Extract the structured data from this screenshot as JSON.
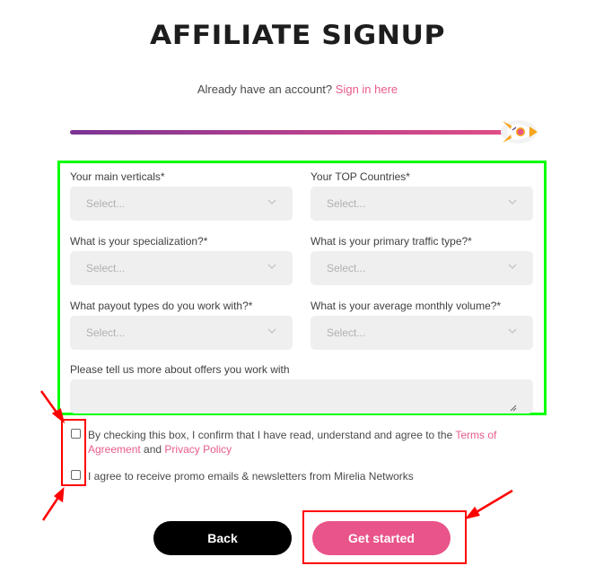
{
  "header": {
    "title": "AFFILIATE SIGNUP",
    "signin_prompt": "Already have an account?",
    "signin_link": "Sign in here"
  },
  "progress": {
    "value_percent": 100,
    "icon": "rocket-icon"
  },
  "form": {
    "fields": [
      {
        "label": "Your main verticals*",
        "placeholder": "Select..."
      },
      {
        "label": "Your TOP Countries*",
        "placeholder": "Select..."
      },
      {
        "label": "What is your specialization?*",
        "placeholder": "Select..."
      },
      {
        "label": "What is your primary traffic type?*",
        "placeholder": "Select..."
      },
      {
        "label": "What payout types do you work with?*",
        "placeholder": "Select..."
      },
      {
        "label": "What is your average monthly volume?*",
        "placeholder": "Select..."
      }
    ],
    "textarea": {
      "label": "Please tell us more about offers you work with",
      "value": ""
    }
  },
  "consents": {
    "terms": {
      "text": "By checking this box, I confirm that I have read, understand and agree to the",
      "terms_link": "Terms of Agreement",
      "and": "and",
      "privacy_link": "Privacy Policy",
      "checked": false
    },
    "newsletter": {
      "text": "I agree to receive promo emails & newsletters from Mirelia Networks",
      "checked": false
    }
  },
  "buttons": {
    "back": "Back",
    "submit": "Get started"
  },
  "colors": {
    "accent": "#e9548a",
    "link": "#e85a8c",
    "progress_start": "#7b3494",
    "progress_end": "#e04e86",
    "annotation_green": "#00ff00",
    "annotation_red": "#ff0000"
  }
}
